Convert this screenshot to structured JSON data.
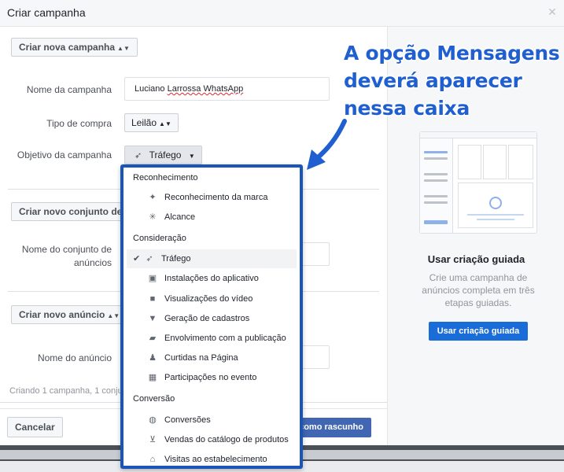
{
  "modal": {
    "title": "Criar campanha",
    "close_icon": "close-icon"
  },
  "campaign": {
    "create_new_button": "Criar nova campanha",
    "name_label": "Nome da campanha",
    "name_value_first": "Luciano ",
    "name_value_underlined": "Larrossa WhatsApp",
    "purchase_type_label": "Tipo de compra",
    "purchase_type_value": "Leilão",
    "objective_label": "Objetivo da campanha",
    "objective_value": "Tráfego"
  },
  "adset": {
    "create_new_button": "Criar novo conjunto de anúncios",
    "name_label_line1": "Nome do conjunto de",
    "name_label_line2": "anúncios"
  },
  "ad": {
    "create_new_button": "Criar novo anúncio",
    "name_label": "Nome do anúncio"
  },
  "footer": {
    "summary": "Criando 1 campanha, 1 conjunto de anúncios e 1 anúncio",
    "cancel_button": "Cancelar",
    "save_draft_button": "Salvar como rascunho"
  },
  "guided": {
    "title": "Usar criação guiada",
    "description": "Crie uma campanha de anúncios completa em três etapas guiadas.",
    "button": "Usar criação guiada"
  },
  "dropdown": {
    "sections": [
      {
        "label": "Reconhecimento",
        "items": [
          {
            "label": "Reconhecimento da marca",
            "icon": "megaphone-icon"
          },
          {
            "label": "Alcance",
            "icon": "reach-icon"
          }
        ]
      },
      {
        "label": "Consideração",
        "items": [
          {
            "label": "Tráfego",
            "icon": "cursor-icon",
            "selected": true
          },
          {
            "label": "Instalações do aplicativo",
            "icon": "box-icon"
          },
          {
            "label": "Visualizações do vídeo",
            "icon": "video-icon"
          },
          {
            "label": "Geração de cadastros",
            "icon": "funnel-icon"
          },
          {
            "label": "Envolvimento com a publicação",
            "icon": "chat-icon"
          },
          {
            "label": "Curtidas na Página",
            "icon": "thumbs-up-icon"
          },
          {
            "label": "Participações no evento",
            "icon": "calendar-icon"
          }
        ]
      },
      {
        "label": "Conversão",
        "items": [
          {
            "label": "Conversões",
            "icon": "globe-icon"
          },
          {
            "label": "Vendas do catálogo de produtos",
            "icon": "cart-icon"
          },
          {
            "label": "Visitas ao estabelecimento",
            "icon": "store-icon"
          }
        ]
      }
    ]
  },
  "annotation": {
    "line1": "A opção Mensagens",
    "line2": "deverá aparecer",
    "line3": "nessa caixa",
    "color": "#1f5fd0"
  }
}
